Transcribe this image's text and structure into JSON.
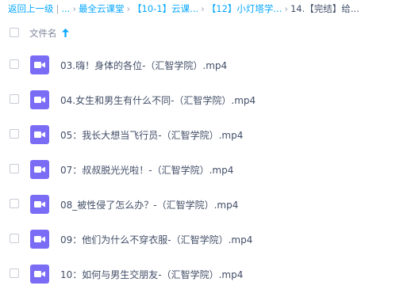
{
  "breadcrumb": {
    "back_label": "返回上一级",
    "items": [
      "...",
      "最全云课堂",
      "【10-1】云课...",
      "【12】小灯塔学...",
      "14.【完结】给..."
    ]
  },
  "header": {
    "column_label": "文件名"
  },
  "colors": {
    "link": "#06a7ff",
    "video_icon_bg": "#7b6cf6",
    "text": "#424e67"
  },
  "files": [
    {
      "name": "03.嗨！身体的各位-（汇智学院）.mp4",
      "icon": "video-file-icon"
    },
    {
      "name": "04.女生和男生有什么不同-（汇智学院）.mp4",
      "icon": "video-file-icon"
    },
    {
      "name": "05：我长大想当飞行员-（汇智学院）.mp4",
      "icon": "video-file-icon"
    },
    {
      "name": "07：叔叔脱光光啦！-（汇智学院）.mp4",
      "icon": "video-file-icon"
    },
    {
      "name": "08_被性侵了怎么办？-（汇智学院）.mp4",
      "icon": "video-file-icon"
    },
    {
      "name": "09：他们为什么不穿衣服-（汇智学院）.mp4",
      "icon": "video-file-icon"
    },
    {
      "name": "10：如何与男生交朋友-（汇智学院）.mp4",
      "icon": "video-file-icon"
    }
  ]
}
